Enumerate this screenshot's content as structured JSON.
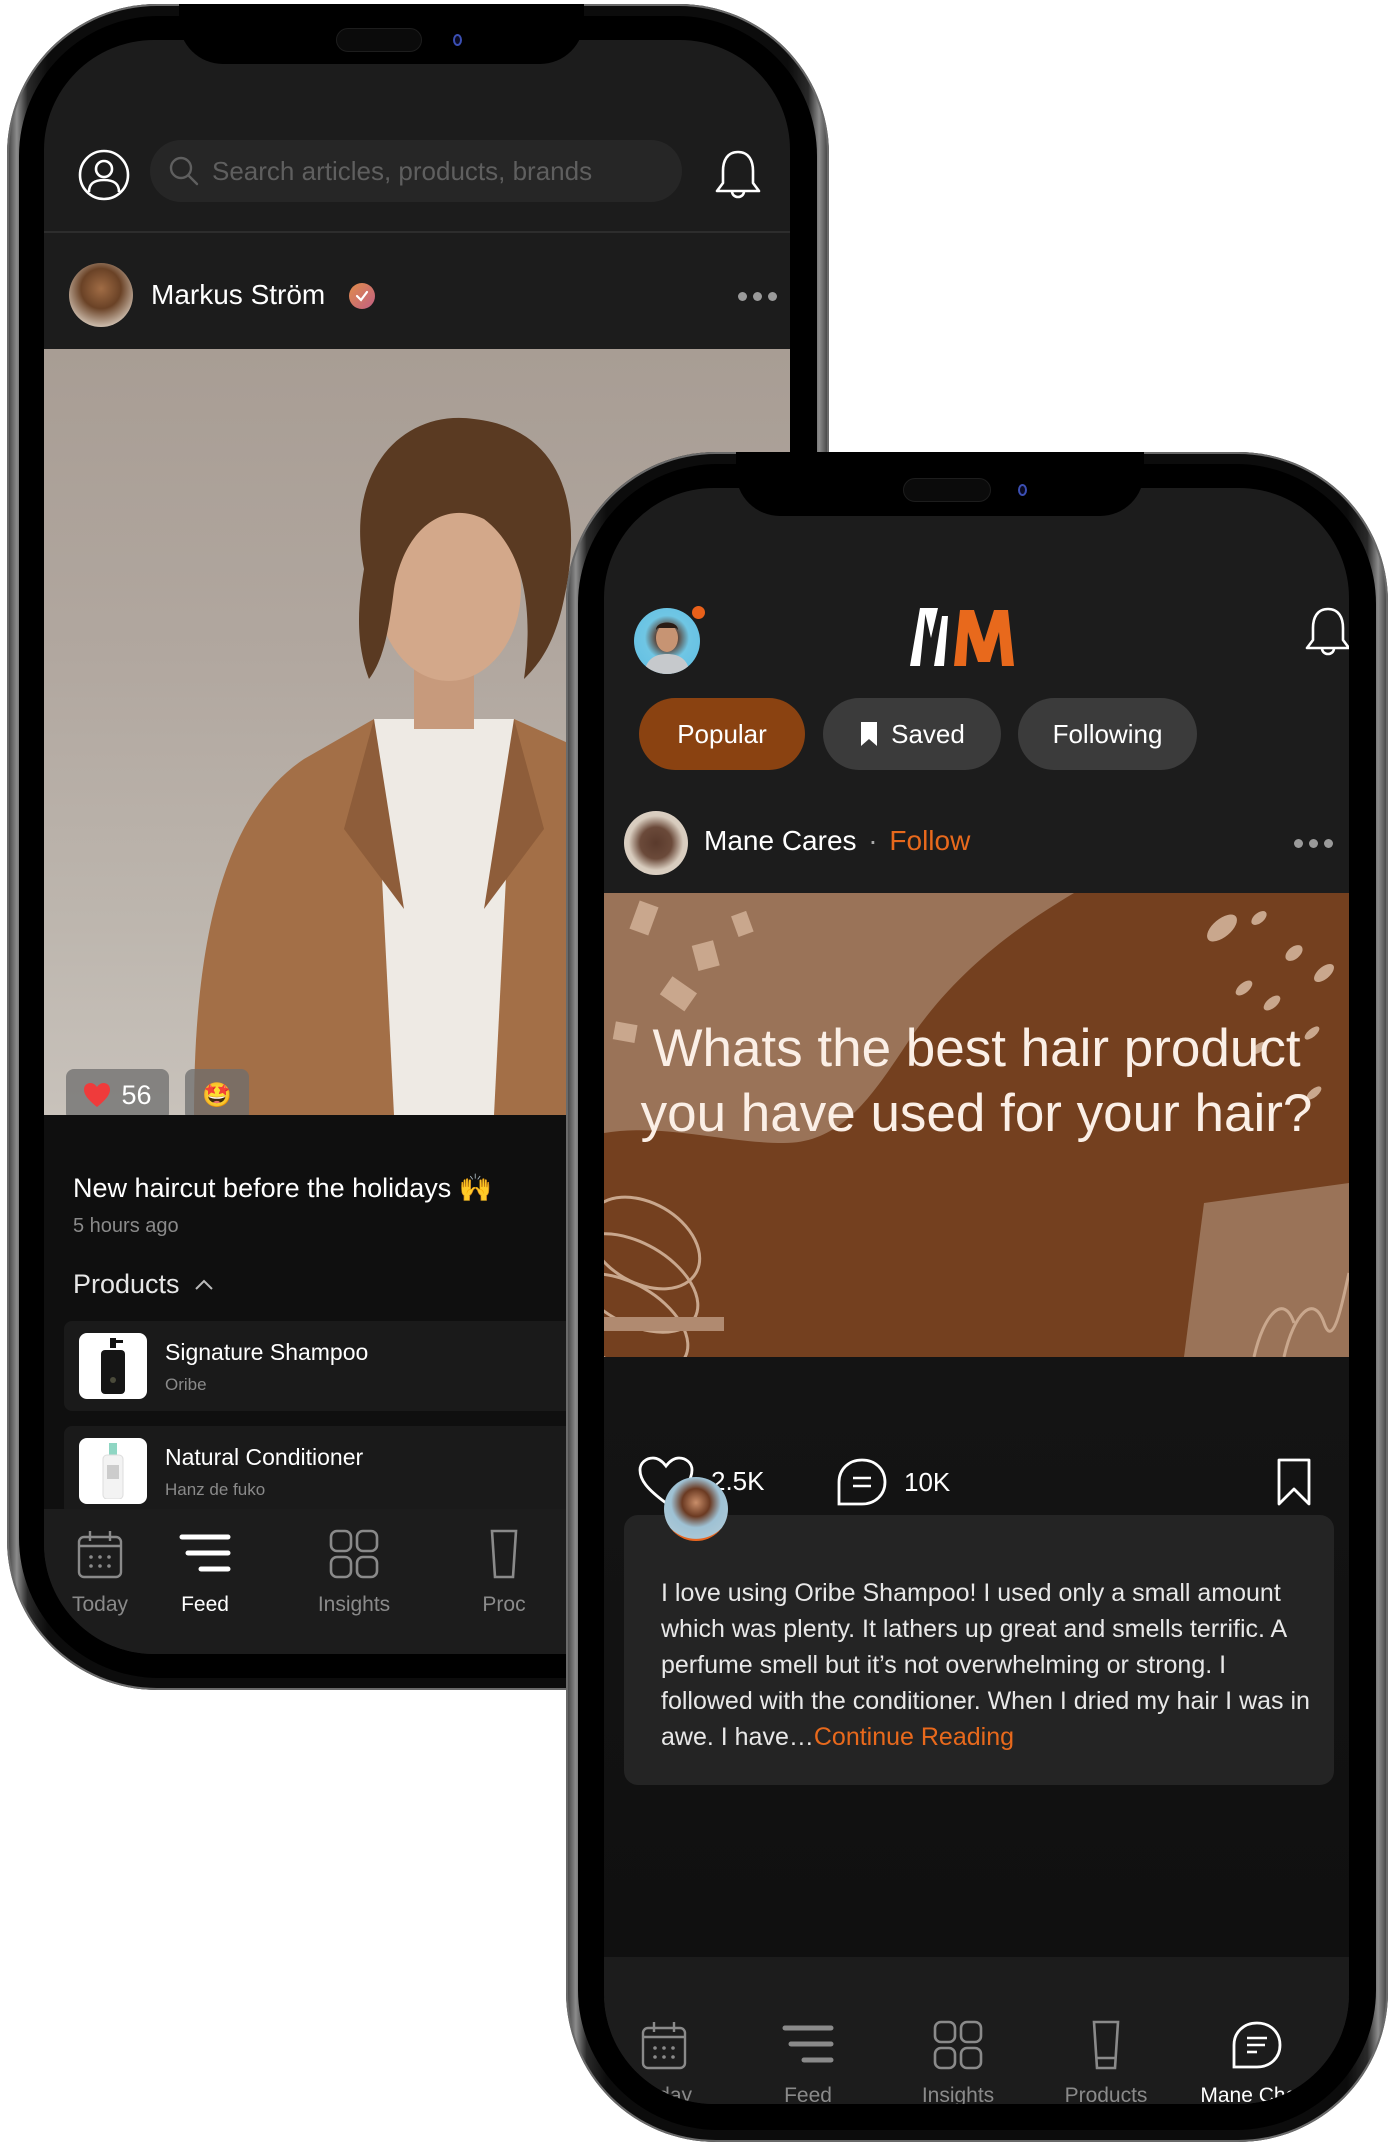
{
  "phone_left": {
    "header": {
      "profile_icon": "user-circle-icon",
      "search_placeholder": "Search articles, products, brands",
      "search_icon": "search-icon",
      "notification_icon": "bell-icon"
    },
    "post": {
      "author": "Markus Ström",
      "verified": true,
      "more_icon": "more-dots-icon",
      "like_count": "56",
      "like_icon": "heart-filled-icon",
      "reaction_emoji": "🤩",
      "caption": "New haircut before the holidays",
      "caption_emoji": "🙌",
      "time_ago": "5 hours ago",
      "products_label": "Products",
      "products": [
        {
          "name": "Signature Shampoo",
          "brand": "Oribe"
        },
        {
          "name": "Natural Conditioner",
          "brand": "Hanz de fuko"
        }
      ]
    },
    "tabbar": {
      "tabs": [
        {
          "label": "Today",
          "icon": "calendar-icon",
          "active": false
        },
        {
          "label": "Feed",
          "icon": "feed-lines-icon",
          "active": true
        },
        {
          "label": "Insights",
          "icon": "grid-icon",
          "active": false
        },
        {
          "label": "Proc",
          "icon": "product-tube-icon",
          "active": false
        }
      ]
    }
  },
  "phone_right": {
    "header": {
      "logo_text": "MM",
      "notification_icon": "bell-icon",
      "has_notification_dot": true
    },
    "filters": [
      {
        "label": "Popular",
        "active": true
      },
      {
        "label": "Saved",
        "icon": "bookmark-icon",
        "active": false
      },
      {
        "label": "Following",
        "active": false
      }
    ],
    "post": {
      "author": "Mane Cares",
      "separator": "·",
      "follow_label": "Follow",
      "question": "Whats the best hair product you have used for your hair?",
      "likes": "2.5K",
      "comments": "10K"
    },
    "comment": {
      "text": "I love using Oribe Shampoo! I used only a small amount which was plenty. It lathers up great and smells terrific. A perfume smell but it’s not overwhelming or strong. I followed with the conditioner. When I dried my hair I was in awe. I have…",
      "continue_label": "Continue Reading"
    },
    "tabbar": {
      "tabs": [
        {
          "label": "Today",
          "icon": "calendar-icon",
          "active": false
        },
        {
          "label": "Feed",
          "icon": "feed-lines-icon",
          "active": false
        },
        {
          "label": "Insights",
          "icon": "grid-icon",
          "active": false
        },
        {
          "label": "Products",
          "icon": "product-tube-icon",
          "active": false
        },
        {
          "label": "Mane Chats",
          "icon": "chat-bubble-icon",
          "active": true
        }
      ]
    }
  },
  "colors": {
    "accent_orange": "#e8691c",
    "popular_pill": "#8a4211",
    "background": "#1c1c1c",
    "muted_text": "#8a8a8a"
  }
}
